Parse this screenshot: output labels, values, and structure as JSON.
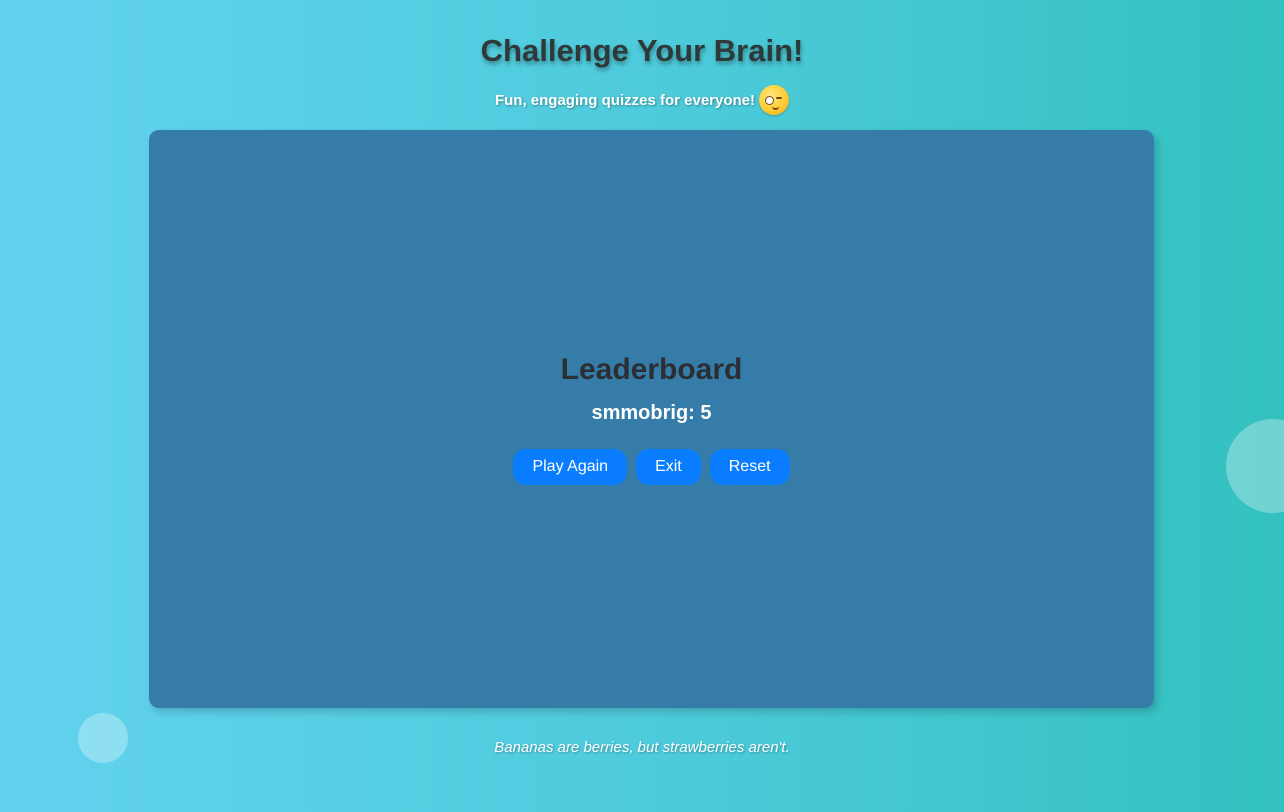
{
  "header": {
    "title": "Challenge Your Brain!",
    "subtitle": "Fun, engaging quizzes for everyone!",
    "subtitle_icon": "winking-face-icon"
  },
  "leaderboard": {
    "title": "Leaderboard",
    "entries": [
      {
        "text": "smmobrig: 5"
      }
    ]
  },
  "actions": {
    "play_again_label": "Play Again",
    "exit_label": "Exit",
    "reset_label": "Reset"
  },
  "footer": {
    "fact": "Bananas are berries, but strawberries aren't."
  },
  "colors": {
    "card_background": "#367ca9",
    "button": "#0a7cff",
    "page_gradient_start": "#62d2ee",
    "page_gradient_end": "#33c1bf"
  }
}
